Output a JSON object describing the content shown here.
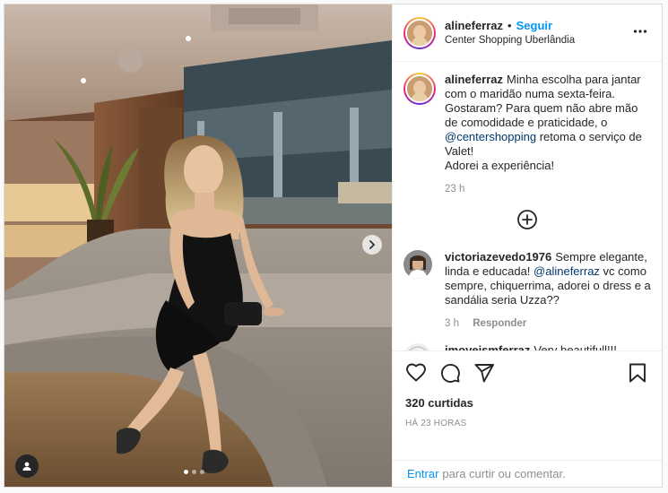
{
  "post": {
    "author": "alineferraz",
    "bullet": "•",
    "follow_label": "Seguir",
    "location": "Center Shopping Uberlândia",
    "more_icon": "more-horizontal-icon",
    "photo": {
      "description_icon": "photo",
      "next_icon": "chevron-right-icon",
      "user_tag_icon": "user-icon",
      "carousel_count": 3,
      "carousel_active": 1
    }
  },
  "caption": {
    "username": "alineferraz",
    "text_part1": "Minha escolha para jantar com o maridão numa sexta-feira. Gostaram? Para quem não abre mão de comodidade e praticidade, o ",
    "mention": "@centershopping",
    "text_part2": " retoma o serviço de Valet!",
    "text_part3": "Adorei a experiência!",
    "time": "23 h"
  },
  "load_more_icon": "plus-circle-icon",
  "comments": [
    {
      "username": "victoriazevedo1976",
      "text_part1": "Sempre elegante, linda e educada! ",
      "mention": "@alineferraz",
      "text_part2": " vc como sempre, chiquerrima, adorei o dress e a sandália seria Uzza??",
      "time": "3 h",
      "reply_label": "Responder"
    },
    {
      "username": "imoveismferraz",
      "text_part1": "Very beautifull!!!"
    }
  ],
  "actions": {
    "like_icon": "heart-icon",
    "comment_icon": "comment-icon",
    "share_icon": "send-icon",
    "save_icon": "bookmark-icon",
    "likes_text": "320 curtidas",
    "timestamp": "HÁ 23 HORAS"
  },
  "login": {
    "link": "Entrar",
    "text": "para curtir ou comentar."
  },
  "colors": {
    "link_blue": "#0095f6",
    "mention_blue": "#00376b",
    "secondary_text": "#8e8e8e"
  }
}
